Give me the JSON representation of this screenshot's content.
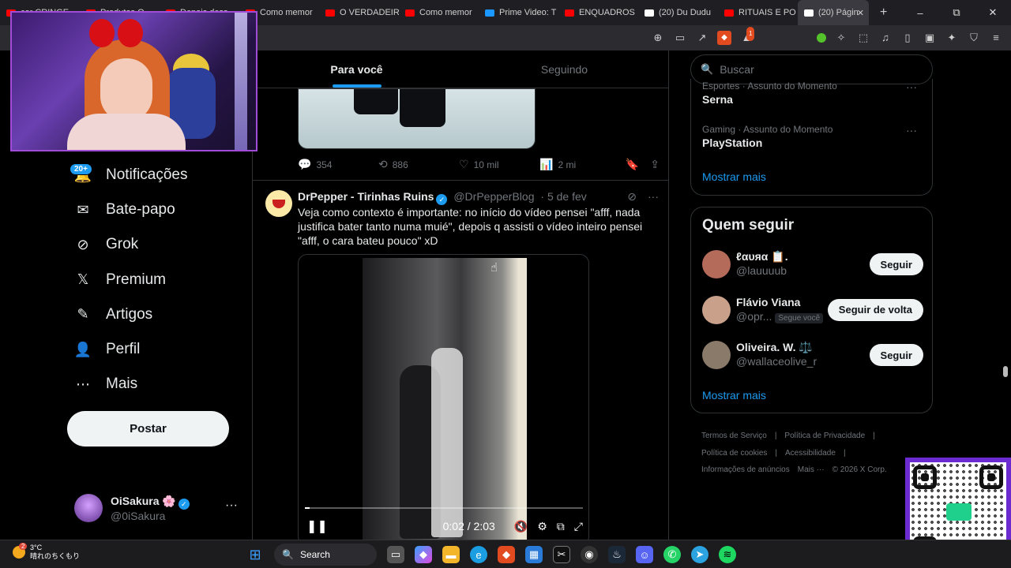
{
  "browser": {
    "tabs": [
      {
        "label": "cor CRINGE",
        "favicon_color": "#ff0000"
      },
      {
        "label": "Produtos O",
        "favicon_color": "#ff0000"
      },
      {
        "label": "Depois dess",
        "favicon_color": "#ff0000"
      },
      {
        "label": "Como memor",
        "favicon_color": "#ff0000"
      },
      {
        "label": "O VERDADEIR",
        "favicon_color": "#ff0000"
      },
      {
        "label": "Como memor",
        "favicon_color": "#ff0000"
      },
      {
        "label": "Prime Video: T",
        "favicon_color": "#1a98ff"
      },
      {
        "label": "ENQUADROS",
        "favicon_color": "#ff0000"
      },
      {
        "label": "(20) Du Dudu",
        "favicon_color": "#ffffff"
      },
      {
        "label": "RITUAIS E PO",
        "favicon_color": "#ff0000"
      }
    ],
    "active_tab": {
      "label": "(20) Págin",
      "favicon_color": "#ffffff"
    },
    "new_tab": "+",
    "window_controls": {
      "minimize": "–",
      "maximize": "⧉",
      "close": "✕"
    },
    "shield_badge": "1"
  },
  "leftnav": {
    "notifications_badge": "20+",
    "items": [
      {
        "label": "Notificações",
        "icon": "bell-icon",
        "glyph": "🔔"
      },
      {
        "label": "Bate-papo",
        "icon": "envelope-icon",
        "glyph": "✉"
      },
      {
        "label": "Grok",
        "icon": "grok-icon",
        "glyph": "⊘"
      },
      {
        "label": "Premium",
        "icon": "x-logo-icon",
        "glyph": "𝕏"
      },
      {
        "label": "Artigos",
        "icon": "articles-icon",
        "glyph": "✎"
      },
      {
        "label": "Perfil",
        "icon": "person-icon",
        "glyph": "👤"
      },
      {
        "label": "Mais",
        "icon": "more-circle-icon",
        "glyph": "⋯"
      }
    ],
    "post_button": "Postar",
    "account": {
      "name": "OiSakura 🌸",
      "handle": "@0iSakura",
      "more": "···"
    }
  },
  "timeline": {
    "tabs": [
      {
        "label": "Para você",
        "active": true
      },
      {
        "label": "Seguindo",
        "active": false
      }
    ],
    "prev_tweet_actions": {
      "replies": "354",
      "reposts": "886",
      "likes": "10 mil",
      "views": "2 mi"
    },
    "tweet": {
      "name": "DrPepper - Tirinhas Ruins",
      "handle": "@DrPepperBlog",
      "date": "· 5 de fev",
      "text": "Veja como contexto é importante: no início do vídeo pensei \"afff, nada justifica bater tanto numa muié\", depois q assisti o vídeo inteiro pensei \"afff, o cara bateu pouco\" xD",
      "video": {
        "time": "0:02 / 2:03",
        "progress": 0.016
      }
    }
  },
  "rightbar": {
    "search_placeholder": "Buscar",
    "trends": [
      {
        "context": "Esportes · Assunto do Momento",
        "title": "Serna"
      },
      {
        "context": "Gaming · Assunto do Momento",
        "title": "PlayStation"
      }
    ],
    "trends_more": "Mostrar mais",
    "who_to_follow_title": "Quem seguir",
    "who_to_follow": [
      {
        "name": "ℓαυяα 📋.",
        "handle": "@lauuuub",
        "tag": "",
        "button": "Seguir",
        "avatar_color": "#b46b5a"
      },
      {
        "name": "Flávio Viana",
        "handle": "@opr...",
        "tag": "Segue você",
        "button": "Seguir de volta",
        "avatar_color": "#c9a08a"
      },
      {
        "name": "Oliveira. W. ⚖️",
        "handle": "@wallaceolive_r",
        "tag": "",
        "button": "Seguir",
        "avatar_color": "#8a7a6a"
      }
    ],
    "follow_more": "Mostrar mais",
    "footer_links": [
      "Termos de Serviço",
      "|",
      "Política de Privacidade",
      "|",
      "Política de cookies",
      "|",
      "Acessibilidade",
      "|",
      "Informações de anúncios",
      "Mais ···",
      "© 2026 X Corp."
    ]
  },
  "taskbar": {
    "weather_temp": "3°C",
    "weather_desc": "晴れのちくもり",
    "weather_badge": "2",
    "search_label": "Search"
  }
}
